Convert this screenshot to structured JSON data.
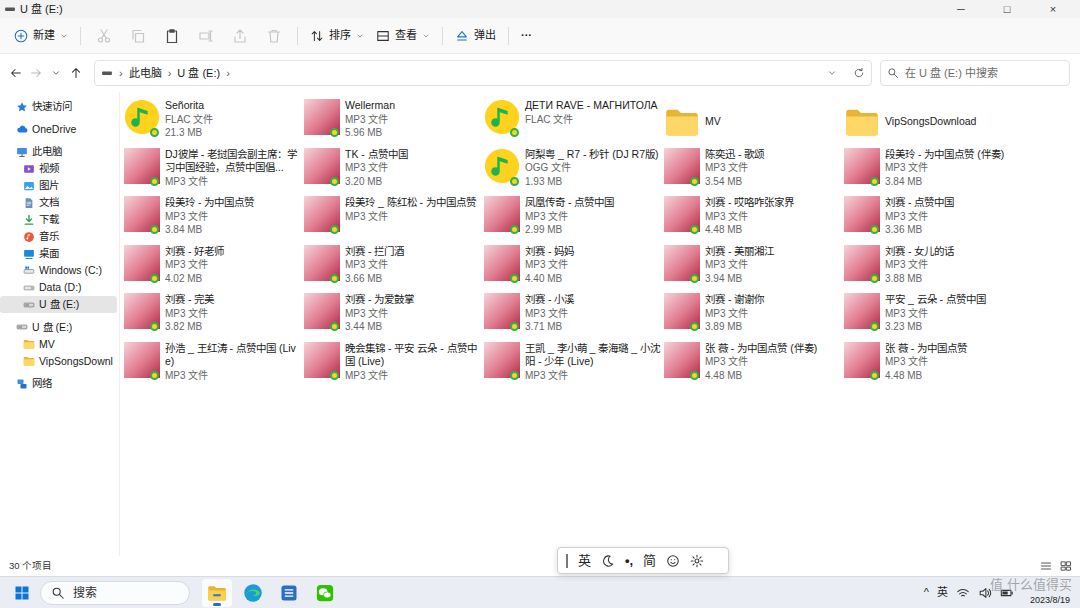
{
  "window": {
    "title": "U 盘 (E:)",
    "controls": [
      "─",
      "□",
      "×"
    ]
  },
  "toolbar": {
    "new": "新建",
    "actions": [
      {
        "kind": "cut",
        "disabled": true
      },
      {
        "kind": "copy",
        "disabled": true
      },
      {
        "kind": "paste",
        "disabled": false
      },
      {
        "kind": "rename",
        "disabled": true
      },
      {
        "kind": "share",
        "disabled": true
      },
      {
        "kind": "delete",
        "disabled": true
      }
    ],
    "sort": "排序",
    "view": "查看",
    "eject": "弹出",
    "more": "···"
  },
  "nav_buttons": [
    {
      "kind": "back",
      "disabled": false
    },
    {
      "kind": "forward",
      "disabled": true
    },
    {
      "kind": "recent",
      "disabled": false
    },
    {
      "kind": "up",
      "disabled": false
    }
  ],
  "address": {
    "crumbs": [
      "此电脑",
      "U 盘 (E:)"
    ],
    "separator": "›"
  },
  "search": {
    "placeholder": "在 U 盘 (E:) 中搜索"
  },
  "sidebar": {
    "items": [
      {
        "label": "快速访问",
        "kind": "star",
        "selected": false
      },
      {
        "label": "OneDrive",
        "kind": "cloud",
        "selected": false
      },
      {
        "label": "此电脑",
        "kind": "pc",
        "selected": false,
        "children": [
          {
            "label": "视频",
            "kind": "video",
            "selected": false
          },
          {
            "label": "图片",
            "kind": "pictures",
            "selected": false
          },
          {
            "label": "文档",
            "kind": "docs",
            "selected": false
          },
          {
            "label": "下载",
            "kind": "download",
            "selected": false
          },
          {
            "label": "音乐",
            "kind": "music",
            "selected": false
          },
          {
            "label": "桌面",
            "kind": "desktop",
            "selected": false
          },
          {
            "label": "Windows (C:)",
            "kind": "windrive",
            "selected": false
          },
          {
            "label": "Data (D:)",
            "kind": "drive",
            "selected": false
          },
          {
            "label": "U 盘 (E:)",
            "kind": "usb",
            "selected": true
          }
        ]
      },
      {
        "label": "U 盘 (E:)",
        "kind": "usb",
        "selected": false,
        "children": [
          {
            "label": "MV",
            "kind": "folder",
            "selected": false
          },
          {
            "label": "VipSongsDownl",
            "kind": "folder",
            "selected": false
          }
        ]
      },
      {
        "label": "网络",
        "kind": "network",
        "selected": false
      }
    ]
  },
  "files": [
    {
      "name": "Señorita",
      "type": "FLAC 文件",
      "size": "21.3 MB",
      "kind": "qq"
    },
    {
      "name": "Wellerman",
      "type": "MP3 文件",
      "size": "5.96 MB",
      "kind": "cover"
    },
    {
      "name": "ДЕТИ RAVE - МАГНИТОЛА",
      "type": "FLAC 文件",
      "kind": "qq"
    },
    {
      "name": "MV",
      "kind": "folder"
    },
    {
      "name": "VipSongsDownload",
      "kind": "folder"
    },
    {
      "name": "DJ彼岸 - 老挝国会副主席：学习中国经验，点赞中国倡...",
      "type": "MP3 文件",
      "kind": "cover"
    },
    {
      "name": "TK - 点赞中国",
      "type": "MP3 文件",
      "size": "3.20 MB",
      "kind": "cover"
    },
    {
      "name": "阿梨粤 _ R7 - 秒针 (DJ R7版)",
      "type": "OGG 文件",
      "size": "1.93 MB",
      "kind": "qq"
    },
    {
      "name": "陈奕迅 - 歌颂",
      "type": "MP3 文件",
      "size": "3.54 MB",
      "kind": "cover"
    },
    {
      "name": "段美玲 - 为中国点赞 (伴奏)",
      "type": "MP3 文件",
      "size": "3.84 MB",
      "kind": "cover"
    },
    {
      "name": "段美玲 - 为中国点赞",
      "type": "MP3 文件",
      "size": "3.84 MB",
      "kind": "cover"
    },
    {
      "name": "段美玲 _ 陈红松 - 为中国点赞",
      "type": "MP3 文件",
      "kind": "cover"
    },
    {
      "name": "凤凰传奇 - 点赞中国",
      "type": "MP3 文件",
      "size": "2.99 MB",
      "kind": "cover"
    },
    {
      "name": "刘赛 - 哎咯咋张家界",
      "type": "MP3 文件",
      "size": "4.48 MB",
      "kind": "cover"
    },
    {
      "name": "刘赛 - 点赞中国",
      "type": "MP3 文件",
      "size": "3.36 MB",
      "kind": "cover"
    },
    {
      "name": "刘赛 - 好老师",
      "type": "MP3 文件",
      "size": "4.02 MB",
      "kind": "cover"
    },
    {
      "name": "刘赛 - 拦门酒",
      "type": "MP3 文件",
      "size": "3.66 MB",
      "kind": "cover"
    },
    {
      "name": "刘赛 - 妈妈",
      "type": "MP3 文件",
      "size": "4.40 MB",
      "kind": "cover"
    },
    {
      "name": "刘赛 - 美丽湘江",
      "type": "MP3 文件",
      "size": "3.94 MB",
      "kind": "cover"
    },
    {
      "name": "刘赛 - 女儿的话",
      "type": "MP3 文件",
      "size": "3.88 MB",
      "kind": "cover"
    },
    {
      "name": "刘赛 - 完美",
      "type": "MP3 文件",
      "size": "3.82 MB",
      "kind": "cover"
    },
    {
      "name": "刘赛 - 为爱鼓掌",
      "type": "MP3 文件",
      "size": "3.44 MB",
      "kind": "cover"
    },
    {
      "name": "刘赛 - 小溪",
      "type": "MP3 文件",
      "size": "3.71 MB",
      "kind": "cover"
    },
    {
      "name": "刘赛 - 谢谢你",
      "type": "MP3 文件",
      "size": "3.89 MB",
      "kind": "cover"
    },
    {
      "name": "平安 _ 云朵 - 点赞中国",
      "type": "MP3 文件",
      "size": "3.23 MB",
      "kind": "cover"
    },
    {
      "name": "孙浩 _ 王红涛 - 点赞中国 (Live)",
      "type": "MP3 文件",
      "kind": "cover"
    },
    {
      "name": "晚会集锦 - 平安 云朵 - 点赞中国 (Live)",
      "type": "MP3 文件",
      "kind": "cover"
    },
    {
      "name": "王凯 _ 李小萌 _ 秦海璐 _ 小沈阳 - 少年 (Live)",
      "type": "MP3 文件",
      "kind": "cover"
    },
    {
      "name": "张 薇 - 为中国点赞 (伴奏)",
      "type": "MP3 文件",
      "size": "4.48 MB",
      "kind": "cover"
    },
    {
      "name": "张 薇 - 为中国点赞",
      "type": "MP3 文件",
      "size": "4.48 MB",
      "kind": "cover"
    }
  ],
  "status_bar": {
    "count": "30 个项目"
  },
  "ime": {
    "lang": "英",
    "punct": "•,",
    "charset": "简"
  },
  "taskbar": {
    "search": "搜索",
    "apps": [
      {
        "kind": "explorer",
        "selected": true
      },
      {
        "kind": "edge",
        "selected": false
      },
      {
        "kind": "word",
        "selected": false
      },
      {
        "kind": "wechat",
        "selected": false
      }
    ],
    "tray": {
      "expand": "^",
      "ime": "英",
      "date": "2023/8/19"
    }
  },
  "watermark": "值 什么值得买"
}
